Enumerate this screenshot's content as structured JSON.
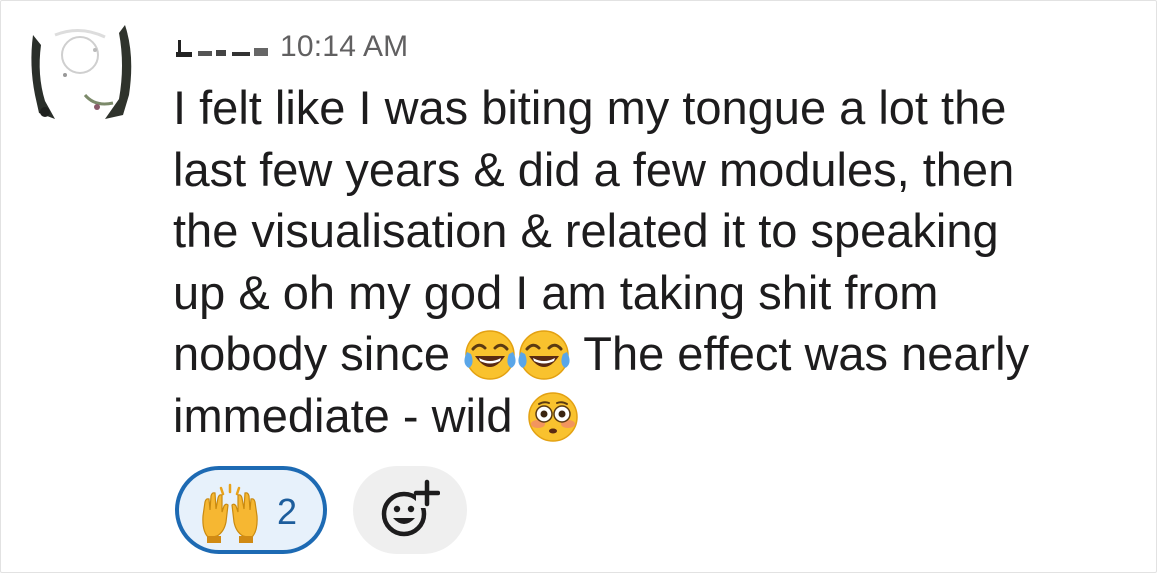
{
  "message": {
    "sender_name": "",
    "timestamp": "10:14 AM",
    "lines": [
      "I felt like I was biting my tongue a lot the",
      "last few years & did a few modules, then",
      "the visualisation & related it to speaking",
      "up & oh my god I am taking shit from"
    ],
    "line5_before": "nobody since",
    "line5_after": "The effect was nearly",
    "line6": "immediate - wild",
    "inline_emojis": [
      "face-with-tears-of-joy-emoji",
      "face-with-tears-of-joy-emoji",
      "flushed-face-emoji"
    ]
  },
  "reactions": [
    {
      "emoji": "raising-hands-emoji",
      "count": "2",
      "selected": true
    }
  ],
  "add_reaction": {
    "icon": "add-reaction-icon"
  },
  "colors": {
    "text": "#1d1c1d",
    "timestamp": "#616061",
    "reaction_border": "#1d6ab3",
    "reaction_bg": "#e7f1fb",
    "add_reaction_bg": "#efefef"
  }
}
